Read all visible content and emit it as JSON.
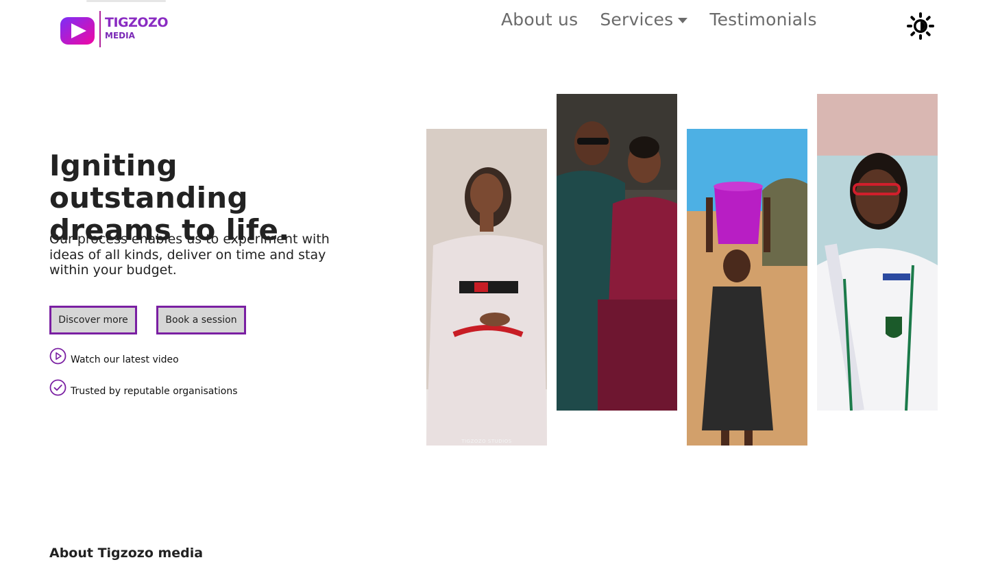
{
  "brand": {
    "name": "TIGZOZO",
    "sub": "MEDIA",
    "colors": {
      "primary": "#7a1fa2",
      "logo_gradient_start": "#7b2ff7",
      "logo_gradient_end": "#f107a3"
    }
  },
  "nav": {
    "items": [
      {
        "label": "About us"
      },
      {
        "label": "Services",
        "has_dropdown": true
      },
      {
        "label": "Testimonials"
      }
    ],
    "theme_toggle_icon": "sun-icon"
  },
  "hero": {
    "title": "Igniting outstanding dreams to life.",
    "subtitle": "Our process enables us to experiment with ideas of all kinds, deliver on time and stay within your budget.",
    "buttons": {
      "discover": "Discover more",
      "book": "Book a session"
    },
    "features": {
      "video": {
        "icon": "play-circle-icon",
        "label": "Watch our latest video"
      },
      "trusted": {
        "icon": "check-circle-icon",
        "label": "Trusted by reputable organisations"
      }
    }
  },
  "gallery": {
    "watermark": "TIGZOZO STUDIOS"
  },
  "about": {
    "heading": "About Tigzozo media"
  }
}
